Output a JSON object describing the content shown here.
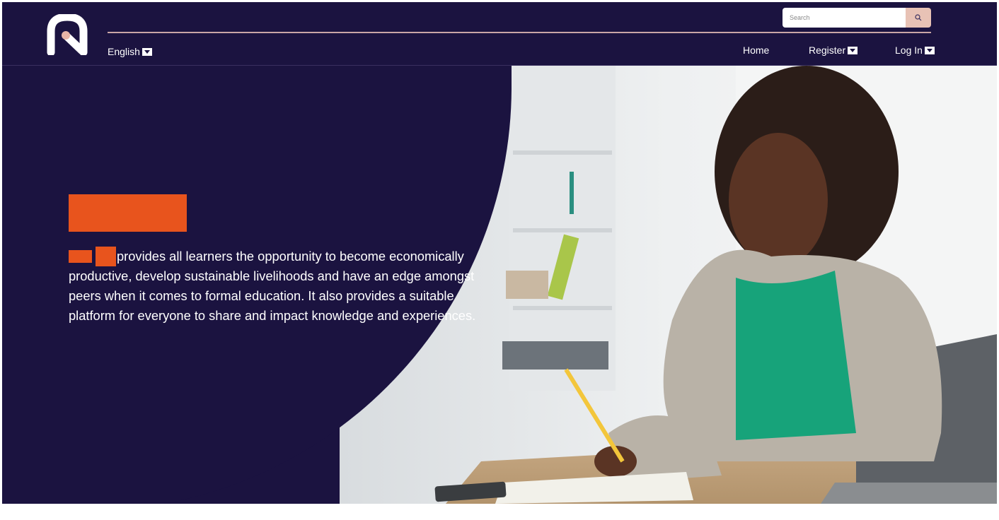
{
  "header": {
    "language": "English",
    "search": {
      "placeholder": "Search"
    },
    "nav": {
      "home": "Home",
      "register": "Register",
      "login": "Log In"
    }
  },
  "hero": {
    "text": "provides  all learners the opportunity to become economically productive, develop sustainable livelihoods and have an edge amongst peers when it comes to formal education. It also provides a suitable platform for everyone to share and impact knowledge and experiences."
  },
  "colors": {
    "primary": "#1b1340",
    "accent": "#e8541d",
    "search_button": "#e8c2b5",
    "logo_dot": "#e8b4a6"
  }
}
